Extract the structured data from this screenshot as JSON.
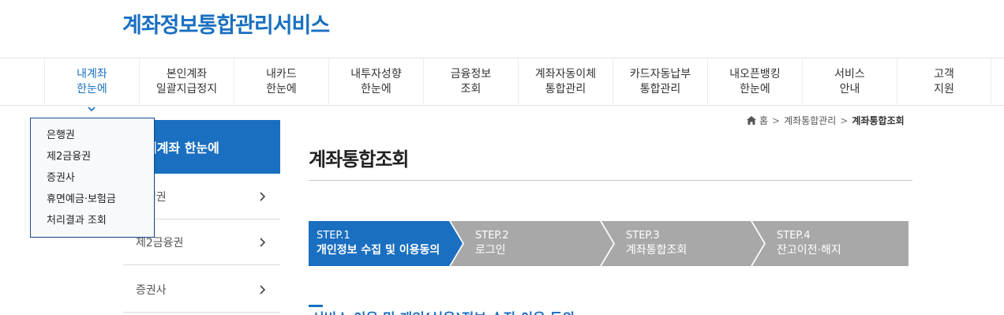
{
  "site": {
    "title": "계좌정보통합관리서비스"
  },
  "gnb": {
    "items": [
      {
        "label": "내계좌\n한눈에",
        "active": true
      },
      {
        "label": "본인계좌\n일괄지급정지"
      },
      {
        "label": "내카드\n한눈에"
      },
      {
        "label": "내투자성향\n한눈에"
      },
      {
        "label": "금융정보\n조회"
      },
      {
        "label": "계좌자동이체\n통합관리"
      },
      {
        "label": "카드자동납부\n통합관리"
      },
      {
        "label": "내오픈뱅킹\n한눈에"
      },
      {
        "label": "서비스\n안내"
      },
      {
        "label": "고객\n지원"
      }
    ]
  },
  "dropdown": {
    "items": [
      "은행권",
      "제2금융권",
      "증권사",
      "휴면예금·보험금",
      "처리결과 조회"
    ]
  },
  "lnb": {
    "header": "내계좌 한눈에",
    "items": [
      "은행권",
      "제2금융권",
      "증권사"
    ]
  },
  "breadcrumb": {
    "home": "홈",
    "level1": "계좌통합관리",
    "current": "계좌통합조회"
  },
  "page": {
    "title": "계좌통합조회"
  },
  "steps": [
    {
      "num": "STEP.1",
      "label": "개인정보 수집 및 이용동의",
      "active": true
    },
    {
      "num": "STEP.2",
      "label": "로그인",
      "active": false
    },
    {
      "num": "STEP.3",
      "label": "계좌통합조회",
      "active": false
    },
    {
      "num": "STEP.4",
      "label": "잔고이전·해지",
      "active": false
    }
  ],
  "section": {
    "title": "서비스 이용 및 개인(신용)정보 수집·이용 동의"
  },
  "colors": {
    "primary": "#1a6fc0",
    "step_inactive": "#a8a8a8"
  },
  "icons": {
    "home": "home-icon",
    "chevron": "chevron-right-icon",
    "gnb_open": "chevron-down-icon"
  }
}
